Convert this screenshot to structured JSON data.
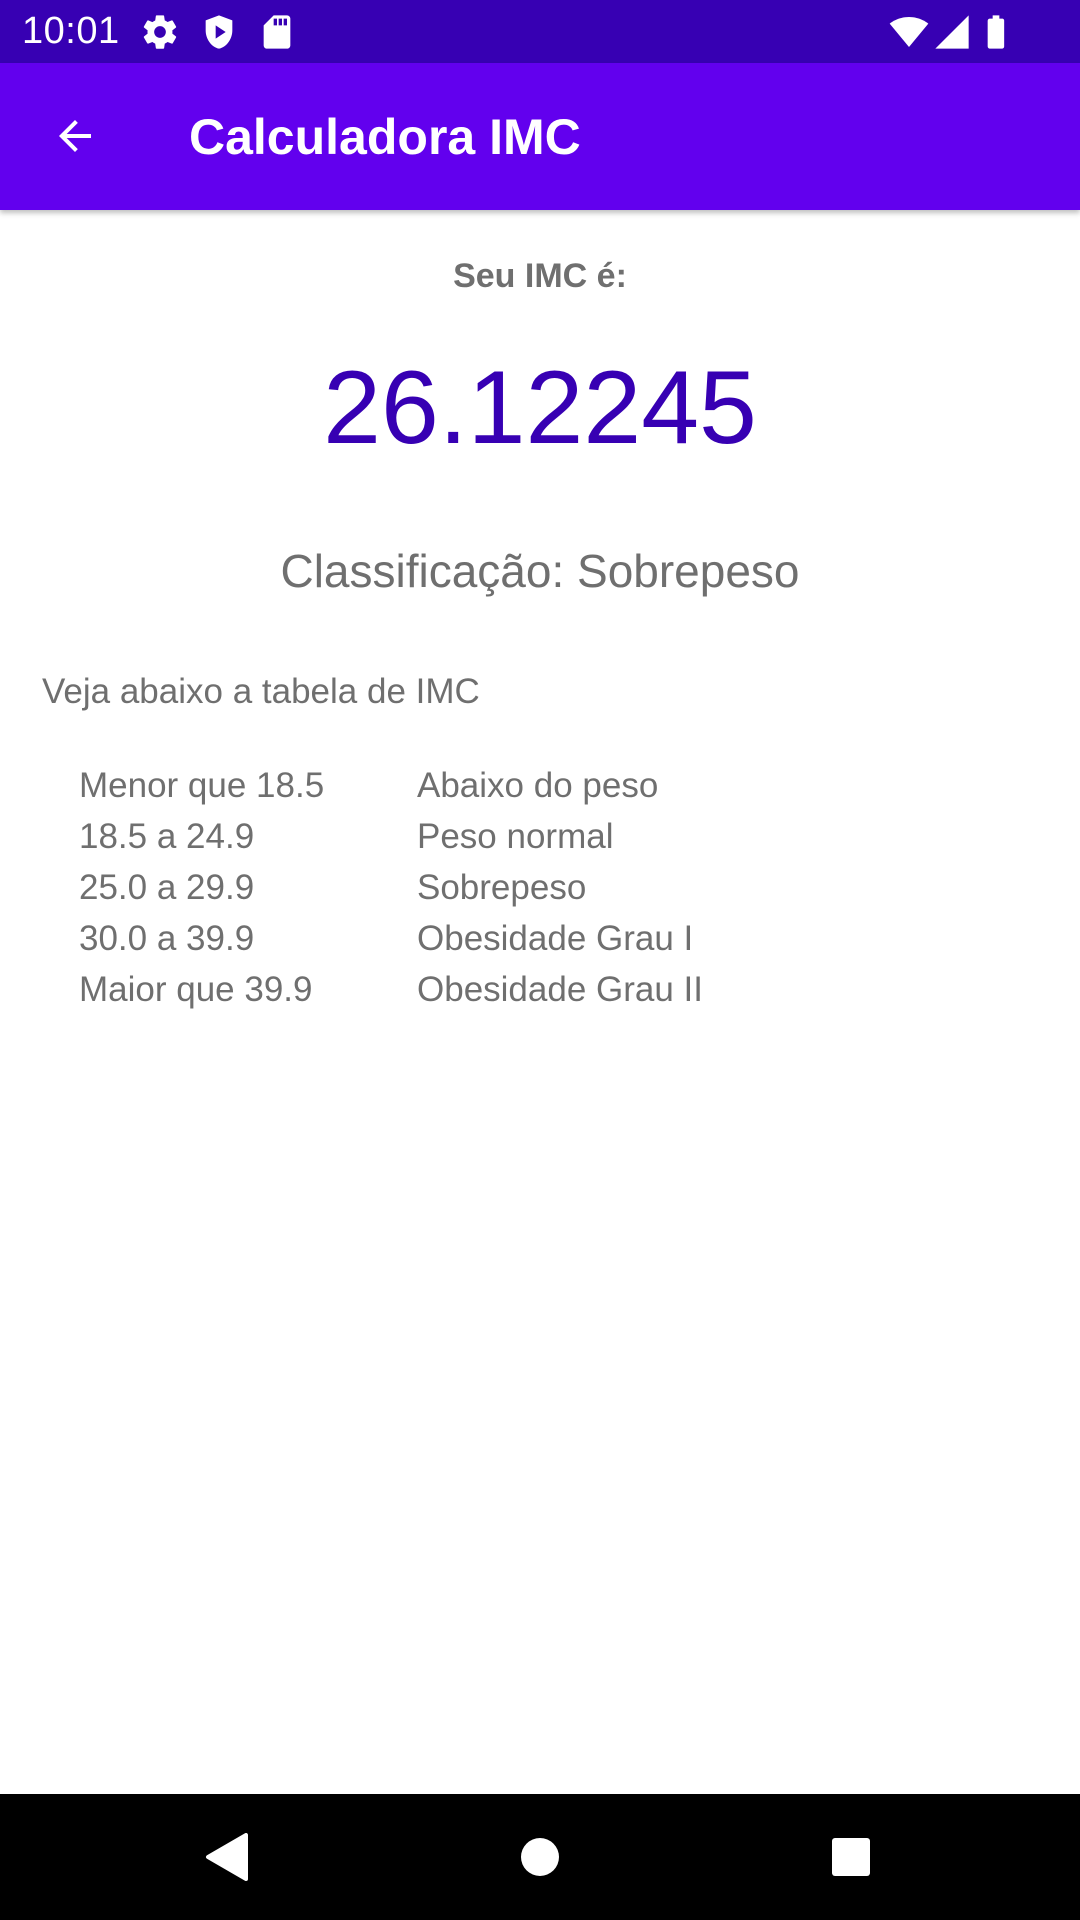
{
  "status_bar": {
    "time": "10:01",
    "icons": [
      "gear-icon",
      "shield-icon",
      "sd-card-icon",
      "wifi-icon",
      "signal-icon",
      "battery-icon"
    ]
  },
  "app_bar": {
    "title": "Calculadora IMC",
    "back_icon": "arrow-left-icon"
  },
  "result": {
    "label": "Seu IMC é:",
    "value": "26.12245",
    "classification": "Classificação: Sobrepeso"
  },
  "table": {
    "intro": "Veja abaixo a tabela de IMC",
    "rows": [
      {
        "range": "Menor que 18.5",
        "classification": "Abaixo do peso"
      },
      {
        "range": "18.5 a 24.9",
        "classification": "Peso normal"
      },
      {
        "range": "25.0 a 29.9",
        "classification": "Sobrepeso"
      },
      {
        "range": "30.0 a 39.9",
        "classification": "Obesidade Grau I"
      },
      {
        "range": "Maior que 39.9",
        "classification": "Obesidade Grau II"
      }
    ]
  },
  "nav_bar": {
    "icons": [
      "back-triangle-icon",
      "home-circle-icon",
      "recents-square-icon"
    ]
  },
  "colors": {
    "status_bar": "#3700b3",
    "app_bar": "#6200ee",
    "imc_value": "#3700b3",
    "secondary_text": "#6f6f6f"
  }
}
